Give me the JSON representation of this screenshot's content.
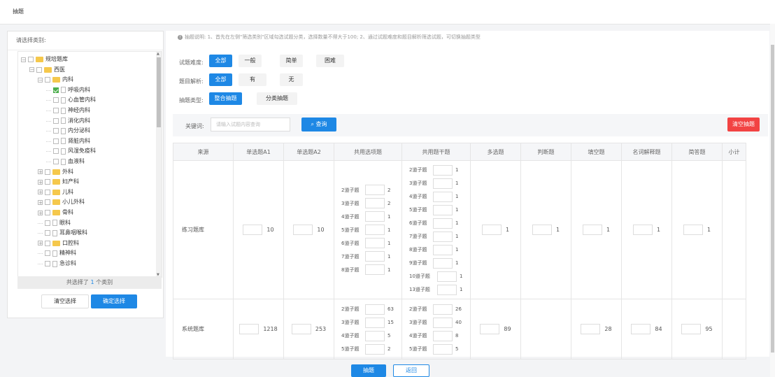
{
  "page": {
    "title": "抽题"
  },
  "left": {
    "header": "请选择类别:",
    "tree": [
      {
        "label": "规培题库",
        "depth": 0,
        "kind": "folder",
        "exp": "−"
      },
      {
        "label": "西医",
        "depth": 1,
        "kind": "folder",
        "exp": "−"
      },
      {
        "label": "内科",
        "depth": 2,
        "kind": "folder",
        "exp": "−"
      },
      {
        "label": "呼吸内科",
        "depth": 3,
        "kind": "file",
        "checked": true
      },
      {
        "label": "心血管内科",
        "depth": 3,
        "kind": "file"
      },
      {
        "label": "神经内科",
        "depth": 3,
        "kind": "file"
      },
      {
        "label": "消化内科",
        "depth": 3,
        "kind": "file"
      },
      {
        "label": "内分泌科",
        "depth": 3,
        "kind": "file"
      },
      {
        "label": "肾脏内科",
        "depth": 3,
        "kind": "file"
      },
      {
        "label": "风湿免疫科",
        "depth": 3,
        "kind": "file"
      },
      {
        "label": "血液科",
        "depth": 3,
        "kind": "file"
      },
      {
        "label": "外科",
        "depth": 2,
        "kind": "folder",
        "exp": "+"
      },
      {
        "label": "妇产科",
        "depth": 2,
        "kind": "folder",
        "exp": "+"
      },
      {
        "label": "儿科",
        "depth": 2,
        "kind": "folder",
        "exp": "+"
      },
      {
        "label": "小儿外科",
        "depth": 2,
        "kind": "folder",
        "exp": "+"
      },
      {
        "label": "骨科",
        "depth": 2,
        "kind": "folder",
        "exp": "+"
      },
      {
        "label": "眼科",
        "depth": 2,
        "kind": "file"
      },
      {
        "label": "耳鼻咽喉科",
        "depth": 2,
        "kind": "file"
      },
      {
        "label": "口腔科",
        "depth": 2,
        "kind": "folder",
        "exp": "+"
      },
      {
        "label": "精神科",
        "depth": 2,
        "kind": "file"
      },
      {
        "label": "急诊科",
        "depth": 2,
        "kind": "file"
      }
    ],
    "count_prefix": "共选择了",
    "count_value": "1",
    "count_suffix": "个类别",
    "clear_btn": "清空选择",
    "confirm_btn": "确定选择"
  },
  "note": "抽题说明: 1、首先在左侧\"筛选类别\"区域勾选试题分类，选择数量不得大于100; 2、通过试题难度和题目解析筛选试题，可切换抽题类型",
  "filters": {
    "difficulty": {
      "label": "试题难度:",
      "options": [
        "全部",
        "一般",
        "简单",
        "困难"
      ]
    },
    "analysis": {
      "label": "题目解析:",
      "options": [
        "全部",
        "有",
        "无"
      ]
    },
    "type": {
      "label": "抽题类型:",
      "options": [
        "整合抽题",
        "分类抽题"
      ]
    }
  },
  "search": {
    "label": "关键词:",
    "placeholder": "请输入试题内容查询",
    "button": "查询",
    "clear": "清空抽题"
  },
  "table": {
    "headers": [
      "来源",
      "单选题A1",
      "单选题A2",
      "共用选项题",
      "共用题干题",
      "多选题",
      "判断题",
      "填空题",
      "名词解释题",
      "简答题",
      "小计"
    ],
    "rows": [
      {
        "source": "练习题库",
        "a1": "10",
        "a2": "10",
        "option_items": [
          [
            "2道子题",
            "2"
          ],
          [
            "3道子题",
            "2"
          ],
          [
            "4道子题",
            "1"
          ],
          [
            "5道子题",
            "1"
          ],
          [
            "6道子题",
            "1"
          ],
          [
            "7道子题",
            "1"
          ],
          [
            "8道子题",
            "1"
          ]
        ],
        "stem_items": [
          [
            "2道子题",
            "1"
          ],
          [
            "3道子题",
            "1"
          ],
          [
            "4道子题",
            "1"
          ],
          [
            "5道子题",
            "1"
          ],
          [
            "6道子题",
            "1"
          ],
          [
            "7道子题",
            "1"
          ],
          [
            "8道子题",
            "1"
          ],
          [
            "9道子题",
            "1"
          ],
          [
            "10道子题",
            "1"
          ],
          [
            "13道子题",
            "1"
          ]
        ],
        "multi": "1",
        "judge": "1",
        "fill": "1",
        "term": "1",
        "short": "1",
        "total": ""
      },
      {
        "source": "系统题库",
        "a1": "1218",
        "a2": "253",
        "option_items": [
          [
            "2道子题",
            "63"
          ],
          [
            "3道子题",
            "15"
          ],
          [
            "4道子题",
            "5"
          ],
          [
            "5道子题",
            "2"
          ]
        ],
        "stem_items": [
          [
            "2道子题",
            "26"
          ],
          [
            "3道子题",
            "40"
          ],
          [
            "4道子题",
            "8"
          ],
          [
            "5道子题",
            "5"
          ]
        ],
        "multi": "89",
        "judge": "",
        "fill": "28",
        "term": "84",
        "short": "95",
        "total": ""
      }
    ]
  },
  "footer": {
    "draw": "抽题",
    "back": "返回"
  }
}
